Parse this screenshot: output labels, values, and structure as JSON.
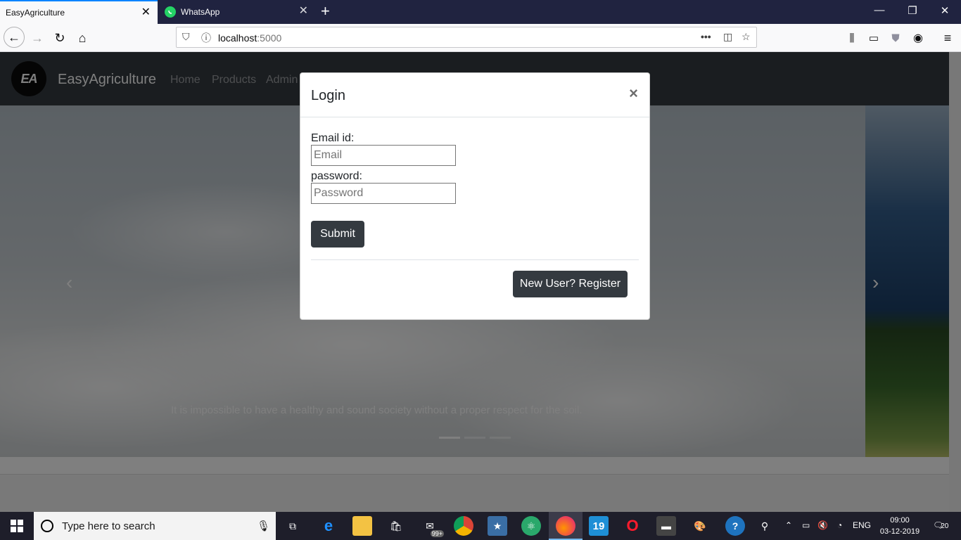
{
  "browser": {
    "tabs": [
      {
        "title": "EasyAgriculture",
        "active": true
      },
      {
        "title": "WhatsApp",
        "active": false
      }
    ],
    "url_host": "localhost",
    "url_port": ":5000"
  },
  "site": {
    "logo": "EA",
    "brand": "EasyAgriculture",
    "nav": [
      "Home",
      "Products",
      "Admin"
    ]
  },
  "carousel": {
    "caption": "It is impossible to have a healthy and sound society without a proper respect for the soil.",
    "prev_icon": "‹",
    "next_icon": "›"
  },
  "modal": {
    "title": "Login",
    "close_icon": "×",
    "email_label": "Email id:",
    "email_placeholder": "Email",
    "password_label": "password:",
    "password_placeholder": "Password",
    "submit": "Submit",
    "register": "New User? Register"
  },
  "taskbar": {
    "search_placeholder": "Type here to search",
    "store_badge": "99+",
    "calendar_badge": "19",
    "language": "ENG",
    "time": "09:00",
    "date": "03-12-2019",
    "notifications": "20"
  },
  "colors": {
    "accent": "#0a84ff",
    "navbar": "#343a40",
    "button": "#343a40"
  }
}
